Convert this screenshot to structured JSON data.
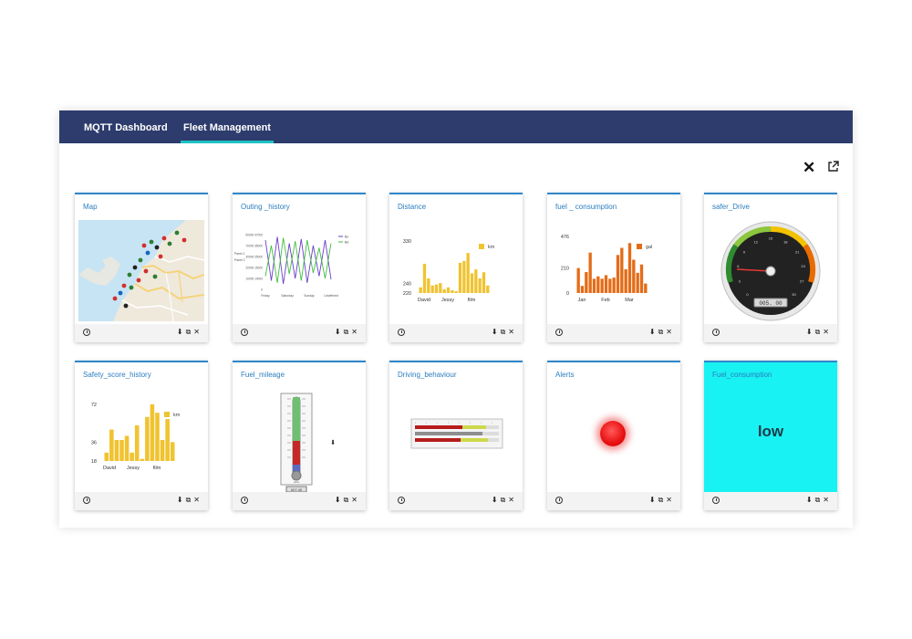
{
  "tabs": [
    {
      "label": "MQTT Dashboard",
      "active": false
    },
    {
      "label": "Fleet Management",
      "active": true
    }
  ],
  "toolbar": {
    "close_icon": "close-icon",
    "open_external_icon": "external-link-icon"
  },
  "widgets": [
    {
      "title": "Map"
    },
    {
      "title": "Outing _history"
    },
    {
      "title": "Distance"
    },
    {
      "title": "fuel _ consumption"
    },
    {
      "title": "safer_Drive"
    },
    {
      "title": "Safety_score_history"
    },
    {
      "title": "Fuel_mileage"
    },
    {
      "title": "Driving_behaviour"
    },
    {
      "title": "Alerts"
    },
    {
      "title": "Fuel_consumption"
    }
  ],
  "footer_icons": [
    "clock-icon",
    "download-icon",
    "external-link-icon",
    "close-icon"
  ],
  "outing_history": {
    "y_ticks": [
      "50000 47000",
      "70000 35000",
      "30000 25000",
      "20000 15000",
      "10000 14000",
      "0"
    ],
    "y_side_labels": [
      "Panel 1",
      "Panel 2"
    ],
    "x_ticks": [
      "Friday",
      "Saturday",
      "Sunday",
      "Undefined"
    ],
    "legend": [
      "Bx",
      "Bd"
    ],
    "colors": [
      "#6a3fc8",
      "#3fbf3f"
    ]
  },
  "distance": {
    "legend": "km",
    "y_ticks": [
      "330",
      "240",
      "220"
    ],
    "x_ticks": [
      "David",
      "Jessy",
      "film"
    ],
    "color": "#f0c330"
  },
  "fuel_consumption_chart": {
    "legend": "gal",
    "y_ticks": [
      "476",
      "210",
      "0"
    ],
    "x_ticks": [
      "Jan",
      "Feb",
      "Mar"
    ],
    "color": "#e46c17"
  },
  "safety_score": {
    "legend": "km",
    "y_ticks": [
      "72",
      "36",
      "18"
    ],
    "x_ticks": [
      "David",
      "Jessy",
      "film"
    ],
    "color": "#f0c330"
  },
  "safer_drive": {
    "readout": "005. 00",
    "dial_labels": [
      "0",
      "3",
      "6",
      "9",
      "12",
      "15",
      "18",
      "21",
      "24",
      "27",
      "30"
    ]
  },
  "fuel_mileage": {
    "readout": "007.40",
    "unit": "L/km"
  },
  "fuel_consumption_value": "low",
  "chart_data": [
    {
      "type": "line",
      "title": "Outing _history",
      "x": [
        "Friday",
        "Saturday",
        "Sunday",
        "Undefined"
      ],
      "series": [
        {
          "name": "Bx",
          "values": [
            45000,
            8000,
            48000,
            5000,
            42000,
            10000,
            46000,
            6000,
            40000,
            12000,
            45000,
            9000
          ]
        },
        {
          "name": "Bd",
          "values": [
            12000,
            40000,
            6000,
            47000,
            14000,
            44000,
            8000,
            45000,
            15000,
            38000,
            10000,
            42000
          ]
        }
      ]
    },
    {
      "type": "bar",
      "title": "Distance",
      "categories": [
        "David",
        "",
        "",
        "",
        "",
        "",
        "Jessy",
        "",
        "",
        "",
        "",
        "",
        "film",
        "",
        "",
        "",
        "",
        ""
      ],
      "series": [
        {
          "name": "km",
          "values": [
            232,
            282,
            251,
            236,
            238,
            241,
            228,
            232,
            226,
            224,
            284,
            288,
            305,
            262,
            270,
            251,
            264,
            236
          ]
        }
      ],
      "ylim": [
        220,
        340
      ]
    },
    {
      "type": "bar",
      "title": "fuel _ consumption",
      "categories": [
        "Jan",
        "",
        "",
        "",
        "",
        "",
        "Feb",
        "",
        "",
        "",
        "",
        "",
        "Mar",
        "",
        "",
        "",
        "",
        ""
      ],
      "series": [
        {
          "name": "gal",
          "values": [
            210,
            60,
            176,
            340,
            120,
            140,
            120,
            150,
            120,
            130,
            320,
            380,
            200,
            420,
            280,
            170,
            240,
            80
          ]
        }
      ],
      "ylim": [
        0,
        476
      ]
    },
    {
      "type": "bar",
      "title": "Safety_score_history",
      "categories": [
        "David",
        "",
        "",
        "",
        "",
        "",
        "Jessy",
        "",
        "",
        "",
        "",
        "",
        "film",
        "",
        "",
        "",
        "",
        ""
      ],
      "series": [
        {
          "name": "km",
          "values": [
            26,
            48,
            38,
            38,
            42,
            26,
            52,
            20,
            60,
            72,
            64,
            38,
            58,
            36
          ]
        }
      ],
      "ylim": [
        18,
        72
      ]
    }
  ]
}
